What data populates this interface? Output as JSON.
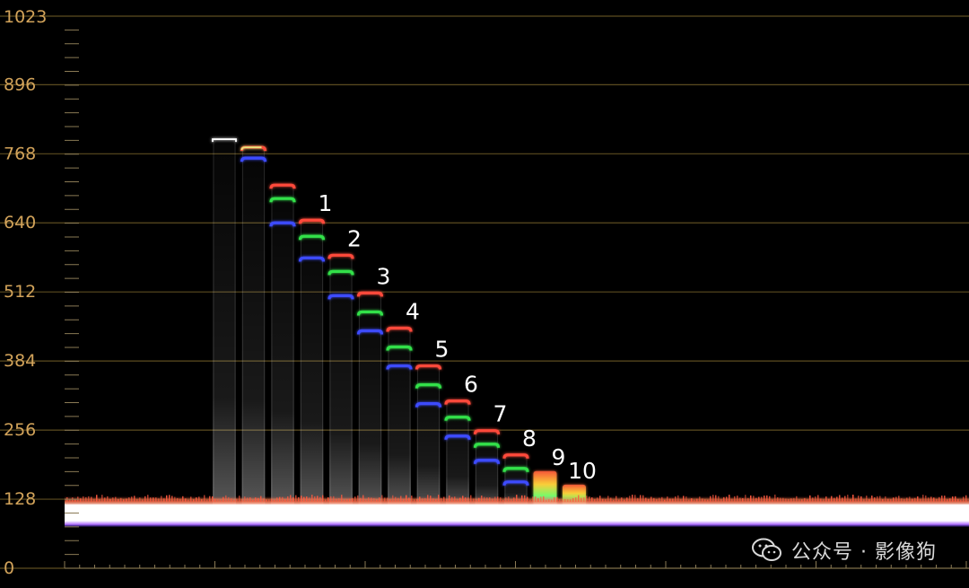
{
  "chart_data": {
    "type": "waveform",
    "ylim": [
      0,
      1023
    ],
    "yticks": [
      "0",
      "128",
      "256",
      "384",
      "512",
      "640",
      "768",
      "896",
      "1023"
    ],
    "ytick_values": [
      0,
      128,
      256,
      384,
      512,
      640,
      768,
      896,
      1023
    ],
    "grid": true,
    "base_level": 110,
    "columns": [
      {
        "label": "",
        "white": 795
      },
      {
        "label": "",
        "red": 780,
        "green": 780,
        "blue": 760
      },
      {
        "label": "",
        "red": 710,
        "green": 685,
        "blue": 640
      },
      {
        "label": "1",
        "red": 645,
        "green": 615,
        "blue": 575
      },
      {
        "label": "2",
        "red": 580,
        "green": 550,
        "blue": 505
      },
      {
        "label": "3",
        "red": 510,
        "green": 475,
        "blue": 440
      },
      {
        "label": "4",
        "red": 445,
        "green": 410,
        "blue": 375
      },
      {
        "label": "5",
        "red": 375,
        "green": 340,
        "blue": 305
      },
      {
        "label": "6",
        "red": 310,
        "green": 280,
        "blue": 245
      },
      {
        "label": "7",
        "red": 255,
        "green": 230,
        "blue": 200
      },
      {
        "label": "8",
        "red": 210,
        "green": 185,
        "blue": 160
      },
      {
        "label": "9",
        "red": 175,
        "green": 160,
        "blue": 145
      },
      {
        "label": "10",
        "red": 150,
        "green": 140,
        "blue": 130
      }
    ],
    "colors": {
      "background": "#000000",
      "grid": "#5c4c20",
      "tick_label": "#d2a35a",
      "red": "#ff4a3a",
      "green": "#33e04a",
      "blue": "#3c4cff",
      "white": "#ffffff",
      "label": "#ffffff"
    }
  },
  "watermark": {
    "text": "公众号 · 影像狗",
    "icon": "wechat-icon"
  }
}
